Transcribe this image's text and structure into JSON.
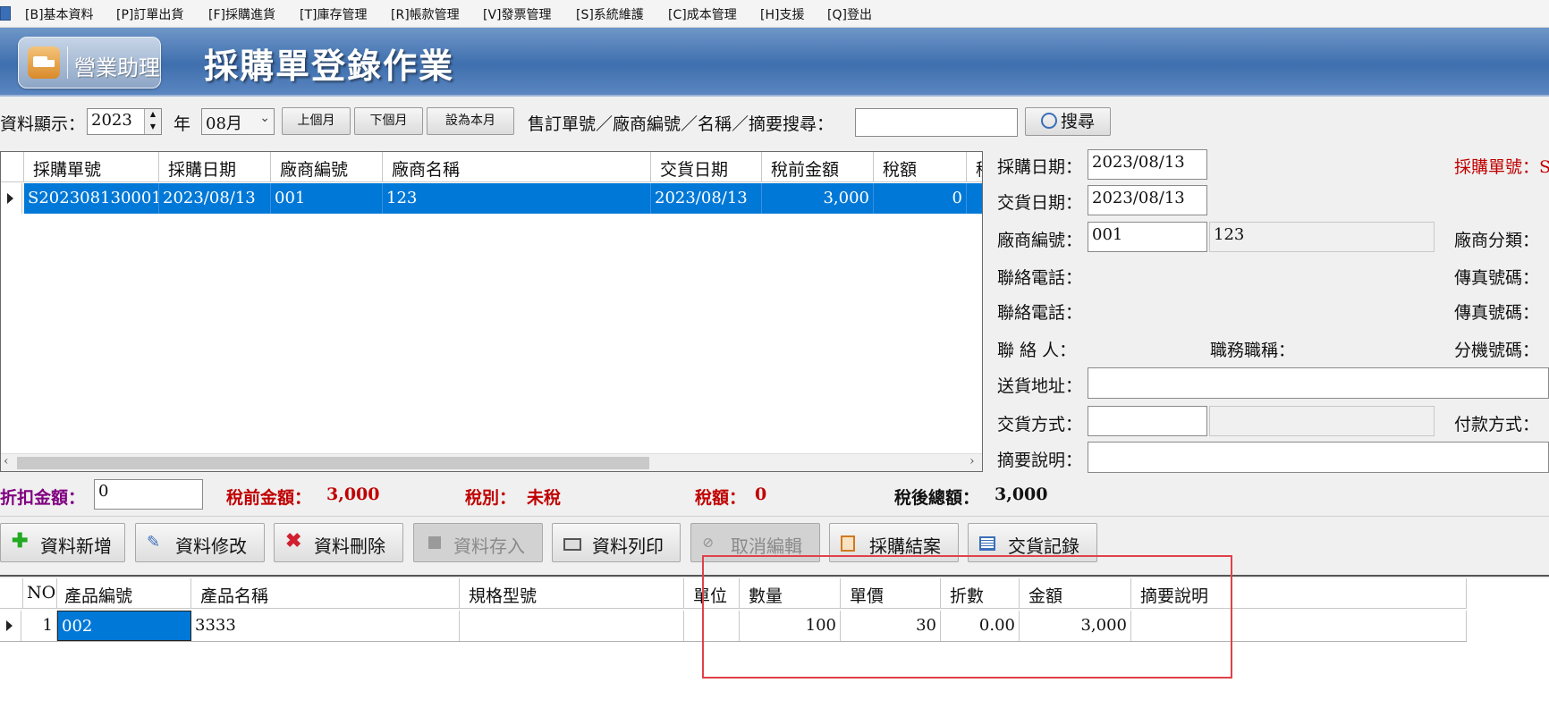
{
  "menu": {
    "items": [
      "[B]基本資料",
      "[P]訂單出貨",
      "[F]採購進貨",
      "[T]庫存管理",
      "[R]帳款管理",
      "[V]發票管理",
      "[S]系統維護",
      "[C]成本管理",
      "[H]支援",
      "[Q]登出"
    ]
  },
  "banner": {
    "badge_text": "營業助理",
    "title": "採購單登錄作業"
  },
  "filter": {
    "data_display_label": "資料顯示：",
    "year_value": "2023",
    "year_label": "年",
    "month_value": "08月",
    "prev_month": "上個月",
    "next_month": "下個月",
    "set_this_month": "設為本月",
    "search_label": "售訂單號／廠商編號／名稱／摘要搜尋：",
    "search_value": "",
    "search_button": "搜尋"
  },
  "orders_grid": {
    "columns": [
      "採購單號",
      "採購日期",
      "廠商編號",
      "廠商名稱",
      "交貨日期",
      "稅前金額",
      "稅額",
      "稅"
    ],
    "rows": [
      {
        "order_no": "S202308130001",
        "order_date": "2023/08/13",
        "vendor_code": "001",
        "vendor_name": "123",
        "delivery_date": "2023/08/13",
        "pretax_amount": "3,000",
        "tax": "0"
      }
    ]
  },
  "form": {
    "order_date_label": "採購日期：",
    "order_date_value": "2023/08/13",
    "order_no_label": "採購單號：S",
    "delivery_date_label": "交貨日期：",
    "delivery_date_value": "2023/08/13",
    "vendor_code_label": "廠商編號：",
    "vendor_code_value": "001",
    "vendor_name_value": "123",
    "vendor_category_label": "廠商分類：",
    "phone1_label": "聯絡電話：",
    "fax1_label": "傳真號碼：",
    "phone2_label": "聯絡電話：",
    "fax2_label": "傳真號碼：",
    "contact_label": "聯 絡 人：",
    "job_title_label": "職務職稱：",
    "extension_label": "分機號碼：",
    "address_label": "送貨地址：",
    "address_value": "",
    "delivery_method_label": "交貨方式：",
    "delivery_method_value": "",
    "payment_method_label": "付款方式：",
    "memo_label": "摘要說明：",
    "memo_value": ""
  },
  "totals": {
    "discount_label": "折扣金額：",
    "discount_value": "0",
    "pretax_label": "稅前金額：",
    "pretax_value": "3,000",
    "tax_type_label": "稅別：",
    "tax_type_value": "未稅",
    "tax_label": "稅額：",
    "tax_value": "0",
    "total_label": "稅後總額：",
    "total_value": "3,000"
  },
  "actions": {
    "add": "資料新增",
    "edit": "資料修改",
    "delete": "資料刪除",
    "save": "資料存入",
    "print": "資料列印",
    "cancel": "取消編輯",
    "close_order": "採購結案",
    "delivery_record": "交貨記錄"
  },
  "detail_grid": {
    "columns": [
      "NO",
      "產品編號",
      "產品名稱",
      "規格型號",
      "單位",
      "數量",
      "單價",
      "折數",
      "金額",
      "摘要說明"
    ],
    "rows": [
      {
        "no": "1",
        "product_code": "002",
        "product_name": "3333",
        "spec": "",
        "unit": "",
        "qty": "100",
        "unit_price": "30",
        "discount": "0.00",
        "amount": "3,000",
        "memo": ""
      }
    ]
  },
  "colors": {
    "selection": "#0078d7",
    "red_text": "#c00000",
    "purple_text": "#800080",
    "highlight_box": "#e0404a"
  }
}
